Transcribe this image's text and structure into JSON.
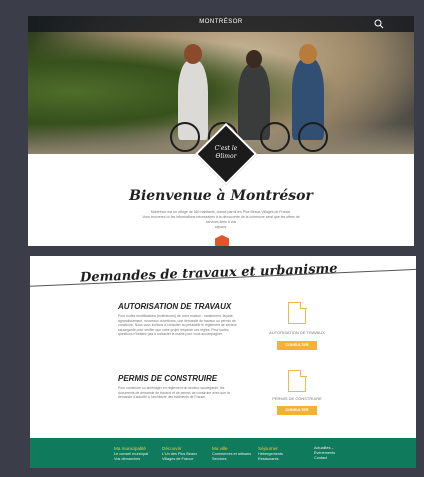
{
  "hero": {
    "site_name": "MONTRÉSOR",
    "logo_line1": "C'est le",
    "logo_line2": "Ѳlimor"
  },
  "welcome": {
    "title": "Bienvenue à Montrésor",
    "intro_line1": "Montrésor est un village de 350 habitants, classé parmi les Plus Beaux Villages de France.",
    "intro_line2": "Vous trouverez ici les informations nécessaires à la découverte de la commune ainsi que les offres de services liées à vos",
    "intro_line3": "séjours."
  },
  "urbanisme": {
    "section_title": "Demandes de travaux et urbanisme",
    "travaux": {
      "title": "AUTORISATION DE TRAVAUX",
      "text": "Pour toutes modifications (extérieures) de votre maison : ravalement, façade, agrandissement, nouveaux ouvertures, une demande de travaux ou permis de construire. Nous vous invitons à consulter au préalable le règlement de secteur sauvegardé pour vérifier que votre projet respecte ces règles. Pour toutes questions n'hésitez pas à contacter la mairie pour vous accompagner.",
      "doc_caption": "AUTORISATION DE TRAVAUX",
      "button": "CONSULTER"
    },
    "permis": {
      "title": "PERMIS DE CONSTRUIRE",
      "text": "Pour construire ou aménager en règlement du secteur sauvegardé, les documents de demande de travaux et de permis de construire avec que la demande d'autorité à l'architecte des bâtiments de France.",
      "doc_caption": "PERMIS DE CONSTRUIRE",
      "button": "CONSULTER"
    }
  },
  "footer": {
    "col1": {
      "head": "Ma municipalité",
      "links": [
        "Le conseil municipal",
        "Vos démarches"
      ]
    },
    "col2": {
      "head": "Découvrir",
      "links": [
        "L'Un des Plus Beaux",
        "Villages de France"
      ]
    },
    "col3": {
      "head": "Ma ville",
      "links": [
        "Commerces et artisans",
        "Services"
      ]
    },
    "col4": {
      "head": "Séjourner",
      "links": [
        "Hébergements",
        "Restaurants"
      ]
    },
    "col5": {
      "links": [
        "Actualités –",
        "Événements",
        "Contact"
      ]
    }
  },
  "colors": {
    "accent": "#f2b234",
    "footer": "#0f7a5c",
    "hero_badge": "#e0552e"
  }
}
